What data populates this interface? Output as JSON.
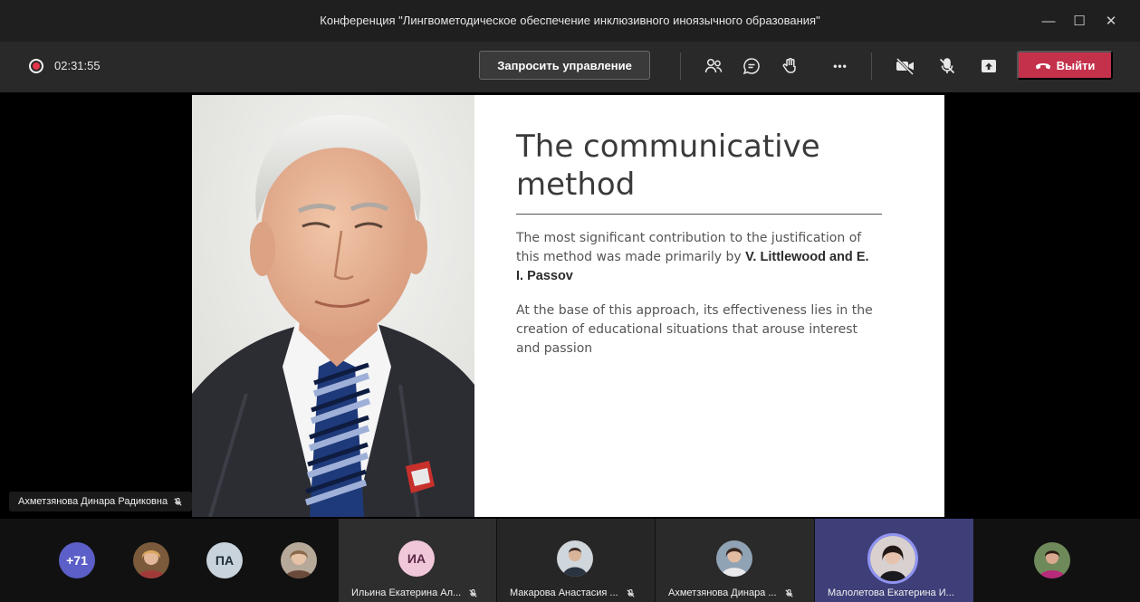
{
  "window": {
    "title": "Конференция \"Лингвометодическое обеспечение инклюзивного иноязычного образования\"",
    "minimize": "—",
    "maximize": "☐",
    "close": "✕"
  },
  "toolbar": {
    "timer": "02:31:55",
    "request_control": "Запросить управление",
    "more": "•••",
    "leave": "Выйти",
    "colors": {
      "leave": "#c4314b",
      "record": "#e3364a"
    }
  },
  "slide": {
    "title": "The communicative method",
    "p1_text": "The most significant contribution to the justification of this method was made primarily by ",
    "p1_bold": "V. Littlewood and E. I. Passov",
    "p2": "At the base of this approach, its effectiveness lies in the creation of educational situations that arouse interest and passion"
  },
  "speaker": {
    "name": "Ахметзянова Динара Радиковна"
  },
  "participants": {
    "overflow": "+71",
    "pa_initials": "ПА",
    "tiles": [
      {
        "initials": "ИА",
        "name": "Ильина Екатерина Ал..."
      },
      {
        "name": "Макарова Анастасия ..."
      },
      {
        "name": "Ахметзянова Динара ..."
      },
      {
        "name": "Малолетова Екатерина И..."
      }
    ]
  }
}
